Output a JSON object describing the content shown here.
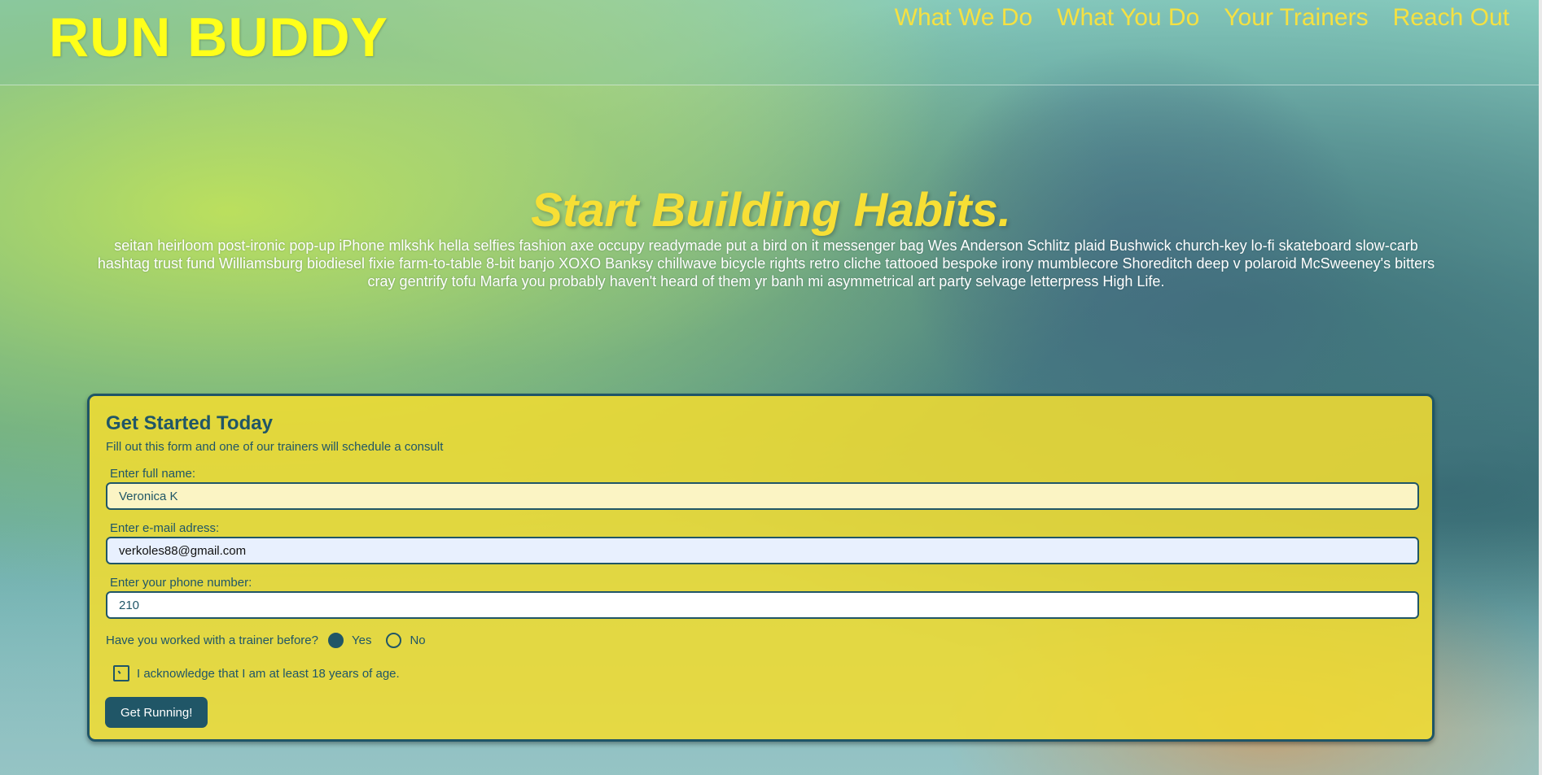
{
  "header": {
    "logo": "RUN BUDDY",
    "nav": [
      "What We Do",
      "What You Do",
      "Your Trainers",
      "Reach Out"
    ]
  },
  "hero": {
    "title": "Start Building Habits.",
    "text": "seitan heirloom post-ironic pop-up iPhone mlkshk hella selfies fashion axe occupy readymade put a bird on it messenger bag Wes Anderson Schlitz plaid Bushwick church-key lo-fi skateboard slow-carb hashtag trust fund Williamsburg biodiesel fixie farm-to-table 8-bit banjo XOXO Banksy chillwave bicycle rights retro cliche tattooed bespoke irony mumblecore Shoreditch deep v polaroid McSweeney's bitters cray gentrify tofu Marfa you probably haven't heard of them yr banh mi asymmetrical art party selvage letterpress High Life."
  },
  "form": {
    "title": "Get Started Today",
    "subtitle": "Fill out this form and one of our trainers will schedule a consult",
    "name_label": "Enter full name:",
    "name_value": "Veronica K",
    "email_label": "Enter e-mail adress:",
    "email_value": "verkoles88@gmail.com",
    "phone_label": "Enter your phone number:",
    "phone_value": "210",
    "question": "Have you worked with a trainer before?",
    "option_yes": "Yes",
    "option_no": "No",
    "selected": "Yes",
    "acknowledge": "I acknowledge that I am at least 18 years of age.",
    "submit": "Get Running!"
  },
  "colors": {
    "logo": "#ffff1a",
    "nav": "#f5e142",
    "hero_title": "#f7df35",
    "card": "#f0dc32",
    "primary": "#205667"
  }
}
